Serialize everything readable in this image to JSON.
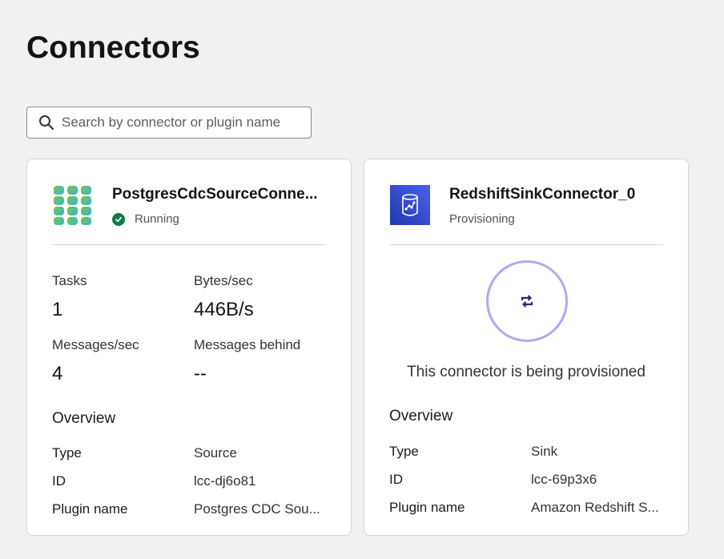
{
  "page": {
    "title": "Connectors"
  },
  "search": {
    "placeholder": "Search by connector or plugin name"
  },
  "cards": [
    {
      "name": "PostgresCdcSourceConne...",
      "status": "Running",
      "icon": "postgres-cdc-logo-icon",
      "metrics": {
        "tasks_label": "Tasks",
        "tasks_value": "1",
        "bytes_label": "Bytes/sec",
        "bytes_value": "446B/s",
        "messages_label": "Messages/sec",
        "messages_value": "4",
        "behind_label": "Messages behind",
        "behind_value": "--"
      },
      "overview": {
        "title": "Overview",
        "type_label": "Type",
        "type_value": "Source",
        "id_label": "ID",
        "id_value": "lcc-dj6o81",
        "plugin_label": "Plugin name",
        "plugin_value": "Postgres CDC Sou..."
      }
    },
    {
      "name": "RedshiftSinkConnector_0",
      "status": "Provisioning",
      "icon": "redshift-logo-icon",
      "provisioning_message": "This connector is being provisioned",
      "overview": {
        "title": "Overview",
        "type_label": "Type",
        "type_value": "Sink",
        "id_label": "ID",
        "id_value": "lcc-69p3x6",
        "plugin_label": "Plugin name",
        "plugin_value": "Amazon Redshift S..."
      }
    }
  ],
  "colors": {
    "running": "#0f7b43",
    "redshift": "#2e42c7",
    "spinner": "#b9a5f5"
  }
}
